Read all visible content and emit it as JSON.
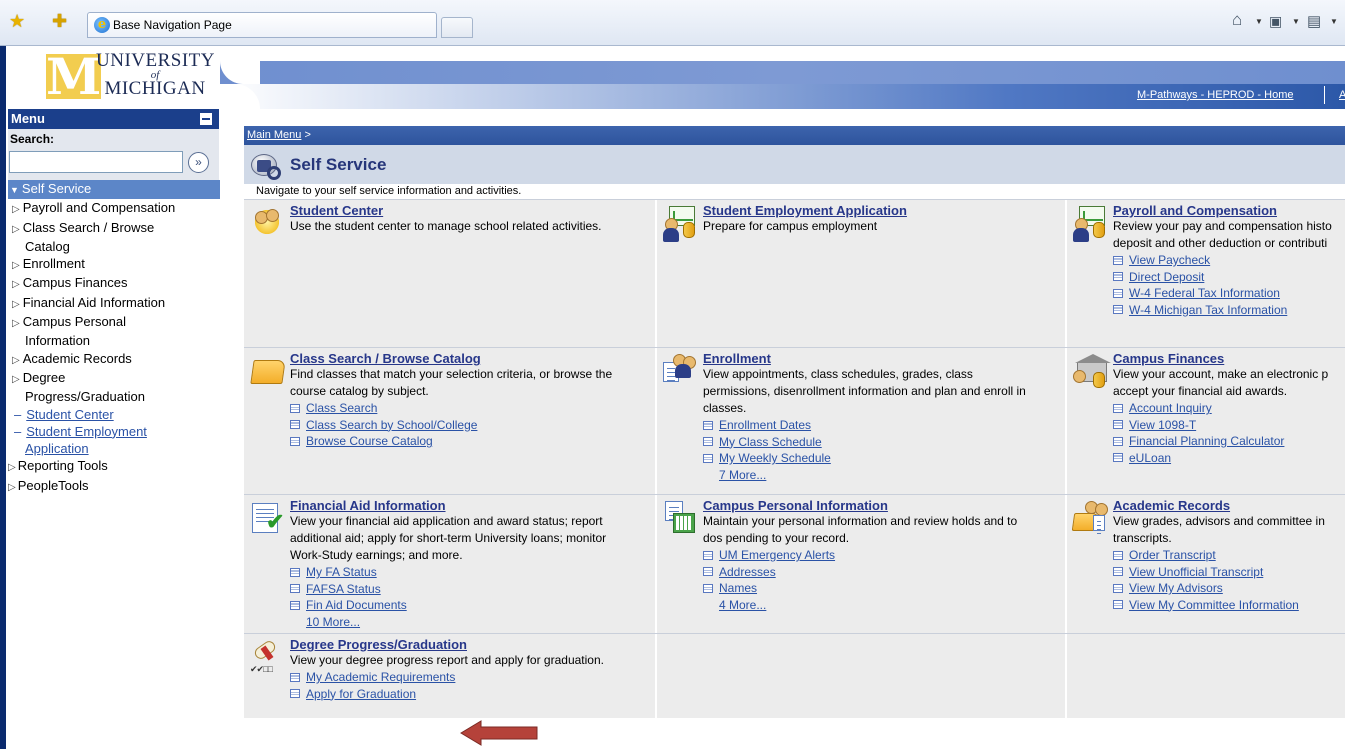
{
  "browser": {
    "tab_title": "Base Navigation Page",
    "commands": [
      "home-icon",
      "feeds-icon",
      "print-icon"
    ]
  },
  "logo": {
    "line1": "UNIVERSITY",
    "line2": "of",
    "line3": "MICHIGAN",
    "letter": "M"
  },
  "header": {
    "home_link": "M-Pathways - HEPROD - Home",
    "next_link": "A"
  },
  "menu": {
    "title": "Menu",
    "search_label": "Search:",
    "search_value": "",
    "self_service": "Self Service",
    "items": [
      "Payroll and Compensation",
      "Class Search / Browse",
      "Catalog",
      "Enrollment",
      "Campus Finances",
      "Financial Aid Information",
      "Campus Personal",
      "Information",
      "Academic Records",
      "Degree",
      "Progress/Graduation"
    ],
    "links": [
      "Student Center",
      "Student Employment",
      "Application"
    ],
    "top_items": [
      "Reporting Tools",
      "PeopleTools"
    ]
  },
  "content": {
    "breadcrumb": "Main Menu",
    "breadcrumb_sep": " >",
    "title": "Self Service",
    "description": "Navigate to your self service information and activities.",
    "cards": {
      "student_center": {
        "title": "Student Center",
        "desc": "Use the student center to manage school related activities."
      },
      "student_employment": {
        "title": "Student Employment Application",
        "desc": "Prepare for campus employment"
      },
      "payroll": {
        "title": "Payroll and Compensation",
        "desc1": "Review your pay and compensation histo",
        "desc2": "deposit and other deduction or contributi",
        "links": [
          "View Paycheck",
          "Direct Deposit",
          "W-4 Federal Tax Information",
          "W-4 Michigan Tax Information"
        ]
      },
      "class_search": {
        "title": "Class Search / Browse Catalog",
        "desc1": "Find classes that match your selection criteria, or browse the",
        "desc2": "course catalog by subject.",
        "links": [
          "Class Search",
          "Class Search by School/College",
          "Browse Course Catalog"
        ]
      },
      "enrollment": {
        "title": "Enrollment",
        "desc1": "View appointments, class schedules, grades, class",
        "desc2": "permissions, disenrollment information and plan and enroll in",
        "desc3": "classes.",
        "links": [
          "Enrollment Dates",
          "My Class Schedule",
          "My Weekly Schedule"
        ],
        "more": "7 More..."
      },
      "campus_finances": {
        "title": "Campus Finances",
        "desc1": "View your account, make an electronic p",
        "desc2": "accept your financial aid awards.",
        "links": [
          "Account Inquiry",
          "View 1098-T",
          "Financial Planning Calculator",
          "eULoan"
        ]
      },
      "financial_aid": {
        "title": "Financial Aid Information",
        "desc1": "View your financial aid application and award status; report",
        "desc2": "additional aid; apply for short-term University loans; monitor",
        "desc3": "Work-Study earnings; and more.",
        "links": [
          "My FA Status",
          "FAFSA Status",
          "Fin Aid Documents"
        ],
        "more": "10 More..."
      },
      "campus_personal": {
        "title": "Campus Personal Information",
        "desc1": "Maintain your personal information and review holds and to",
        "desc2": "dos pending to your record.",
        "links": [
          "UM Emergency Alerts",
          "Addresses",
          "Names"
        ],
        "more": "4 More..."
      },
      "academic_records": {
        "title": "Academic Records",
        "desc1": "View grades, advisors and committee in",
        "desc2": "transcripts.",
        "links": [
          "Order Transcript",
          "View Unofficial Transcript",
          "View My Advisors",
          "View My Committee Information"
        ]
      },
      "degree_progress": {
        "title": "Degree Progress/Graduation",
        "desc": "View your degree progress report and apply for graduation.",
        "links": [
          "My Academic Requirements",
          "Apply for Graduation"
        ]
      }
    }
  },
  "colors": {
    "menu_header": "#1b3f8b",
    "selected_item": "#5c86c8",
    "link": "#2a52a6",
    "card_bg": "#ececec",
    "arrow": "#b5423a"
  }
}
